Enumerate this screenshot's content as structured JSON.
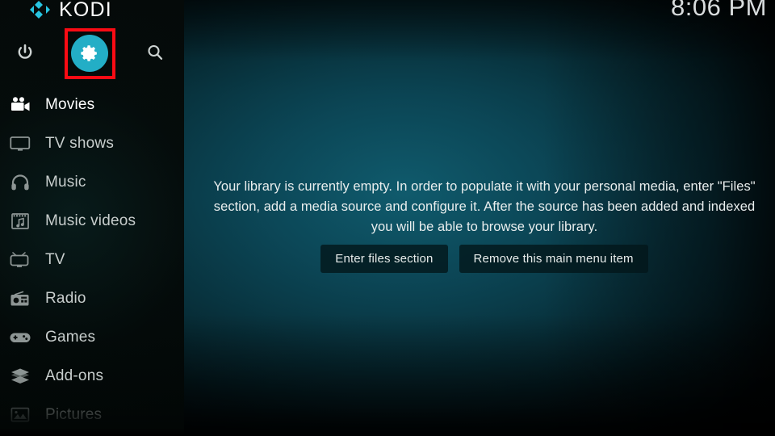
{
  "app": {
    "name": "KODI",
    "logo_icon": "kodi-logo-icon",
    "accent_color": "#23aec6",
    "highlight_color": "#fb0b14"
  },
  "statusbar": {
    "clock": "8:06 PM"
  },
  "toolbar": {
    "power_label": "Power",
    "power_icon": "power-icon",
    "settings_label": "Settings",
    "settings_icon": "gear-icon",
    "settings_highlighted": "true",
    "search_label": "Search",
    "search_icon": "search-icon"
  },
  "sidebar": {
    "items": [
      {
        "label": "Movies",
        "icon": "movie-camera-icon",
        "state": "focused"
      },
      {
        "label": "TV shows",
        "icon": "television-icon",
        "state": "normal"
      },
      {
        "label": "Music",
        "icon": "headphones-icon",
        "state": "normal"
      },
      {
        "label": "Music videos",
        "icon": "film-strip-note-icon",
        "state": "normal"
      },
      {
        "label": "TV",
        "icon": "retro-tv-icon",
        "state": "normal"
      },
      {
        "label": "Radio",
        "icon": "radio-icon",
        "state": "normal"
      },
      {
        "label": "Games",
        "icon": "gamepad-icon",
        "state": "normal"
      },
      {
        "label": "Add-ons",
        "icon": "addon-box-icon",
        "state": "normal"
      },
      {
        "label": "Pictures",
        "icon": "picture-icon",
        "state": "dim"
      }
    ]
  },
  "main": {
    "empty_message": "Your library is currently empty. In order to populate it with your personal media, enter \"Files\" section, add a media source and configure it. After the source has been added and indexed you will be able to browse your library.",
    "buttons": [
      {
        "label": "Enter files section"
      },
      {
        "label": "Remove this main menu item"
      }
    ]
  }
}
